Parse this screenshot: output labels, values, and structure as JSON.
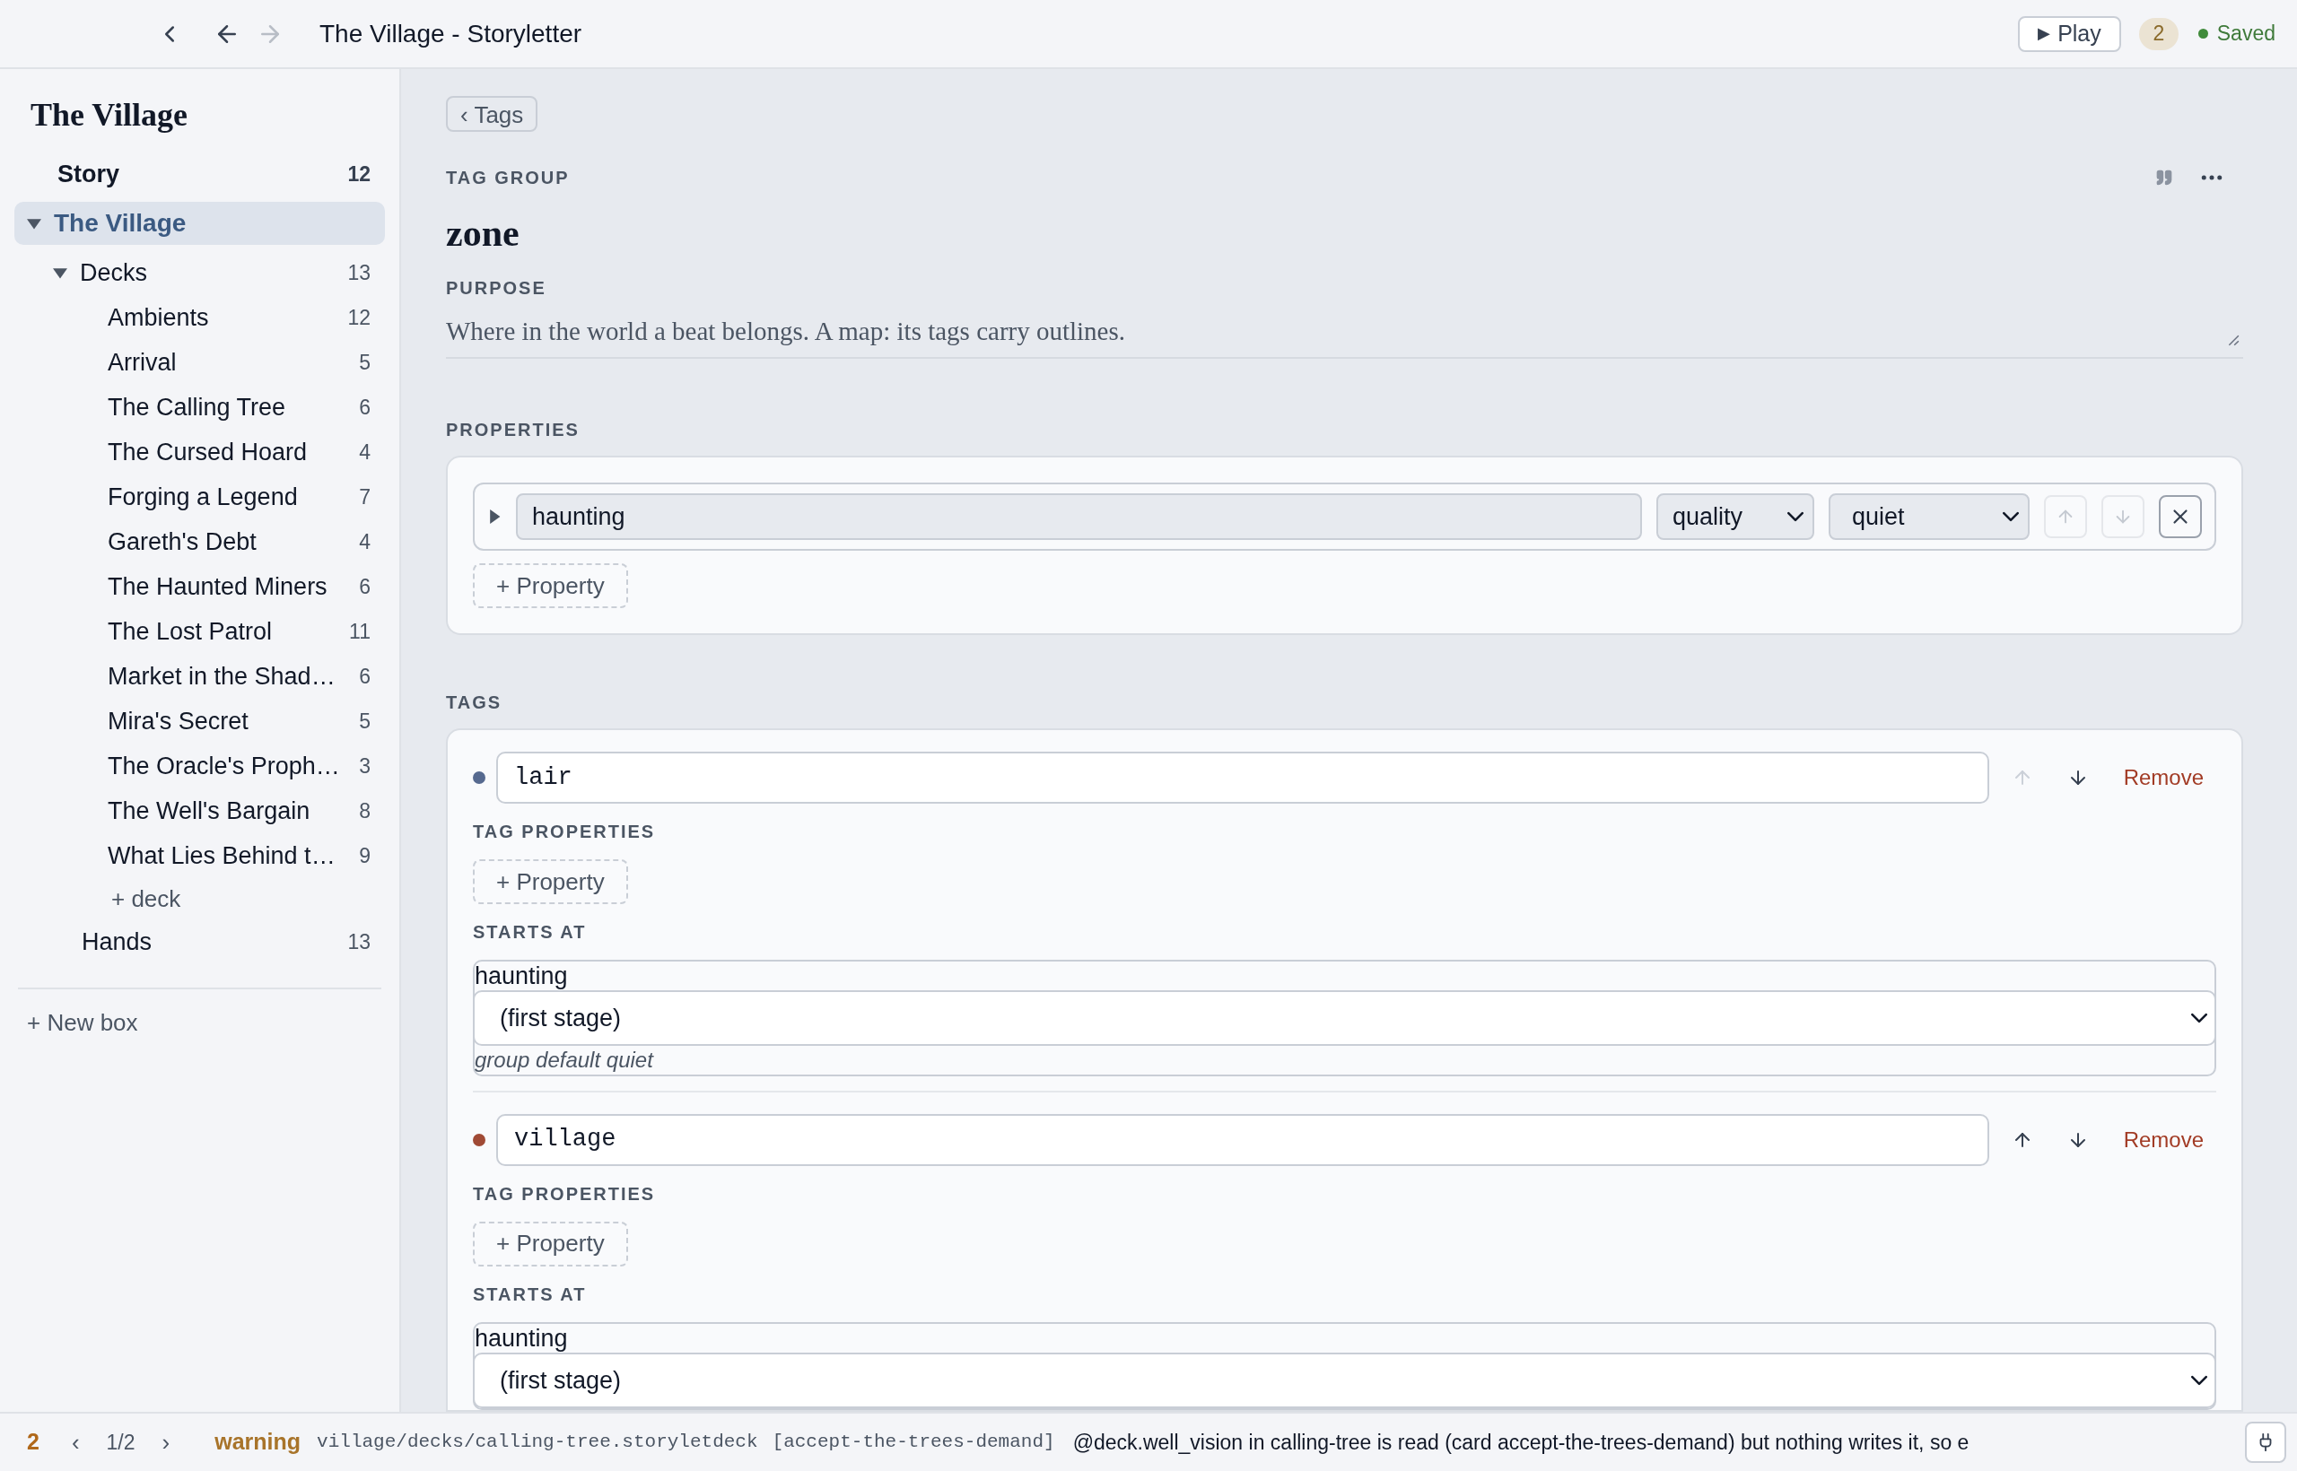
{
  "topbar": {
    "title": "The Village - Storyletter",
    "play": "Play",
    "play_icon": "▶",
    "count": "2",
    "status": "Saved"
  },
  "sidebar": {
    "title": "The Village",
    "items": [
      {
        "label": "Story",
        "count": "12",
        "kind": "heading",
        "selected": false
      },
      {
        "label": "The Village",
        "kind": "group",
        "selected": true,
        "expanded": true,
        "children": [
          {
            "label": "Decks",
            "count": "13",
            "kind": "item",
            "selected": false,
            "expanded": true,
            "children": [
              {
                "label": "Ambients",
                "count": "12",
                "kind": "item",
                "selected": false
              },
              {
                "label": "Arrival",
                "count": "5",
                "kind": "item",
                "selected": false
              },
              {
                "label": "The Calling Tree",
                "count": "6",
                "kind": "item",
                "selected": false
              },
              {
                "label": "The Cursed Hoard",
                "count": "4",
                "kind": "item",
                "selected": false
              },
              {
                "label": "Forging a Legend",
                "count": "7",
                "kind": "item",
                "selected": false
              },
              {
                "label": "Gareth's Debt",
                "count": "4",
                "kind": "item",
                "selected": false
              },
              {
                "label": "The Haunted Miners",
                "count": "6",
                "kind": "item",
                "selected": false
              },
              {
                "label": "The Lost Patrol",
                "count": "11",
                "kind": "item",
                "selected": false
              },
              {
                "label": "Market in the Shad…",
                "count": "6",
                "kind": "item",
                "selected": false
              },
              {
                "label": "Mira's Secret",
                "count": "5",
                "kind": "item",
                "selected": false
              },
              {
                "label": "The Oracle's Proph…",
                "count": "3",
                "kind": "item",
                "selected": false
              },
              {
                "label": "The Well's Bargain",
                "count": "8",
                "kind": "item",
                "selected": false
              },
              {
                "label": "What Lies Behind t…",
                "count": "9",
                "kind": "item",
                "selected": false
              },
              {
                "label": "+ deck",
                "kind": "action",
                "selected": false
              }
            ]
          },
          {
            "label": "Hands",
            "count": "13",
            "kind": "item",
            "selected": false
          }
        ]
      }
    ],
    "new_box": "+ New box"
  },
  "main": {
    "back": "‹ Tags",
    "eyebrow": "TAG GROUP",
    "name": "zone",
    "purpose_label": "PURPOSE",
    "purpose": "Where in the world a beat belongs. A map: its tags carry outlines.",
    "properties_label": "PROPERTIES",
    "properties": [
      {
        "name": "haunting",
        "type": "quality",
        "default": "quiet",
        "up_disabled": true,
        "down_disabled": true
      }
    ],
    "add_property": "+ Property",
    "tags_label": "TAGS",
    "tags": [
      {
        "name": "lair",
        "color": "#56698f",
        "up_disabled": true,
        "down_disabled": false,
        "remove": "Remove",
        "props_label": "TAG PROPERTIES",
        "add_property": "+ Property",
        "starts_label": "STARTS AT",
        "start_property": "haunting",
        "start_value": "(first stage)",
        "hint": "group default quiet"
      },
      {
        "name": "village",
        "color": "#a04a35",
        "up_disabled": false,
        "down_disabled": false,
        "remove": "Remove",
        "props_label": "TAG PROPERTIES",
        "add_property": "+ Property",
        "starts_label": "STARTS AT",
        "start_property": "haunting",
        "start_value": "(first stage)"
      }
    ]
  },
  "statusbar": {
    "count": "2",
    "prev": "‹",
    "page": "1/2",
    "next": "›",
    "level": "warning",
    "file": "village/decks/calling-tree.storyletdeck",
    "card": "[accept-the-trees-demand]",
    "message": "@deck.well_vision in calling-tree is read (card accept-the-trees-demand) but nothing writes it, so e"
  }
}
